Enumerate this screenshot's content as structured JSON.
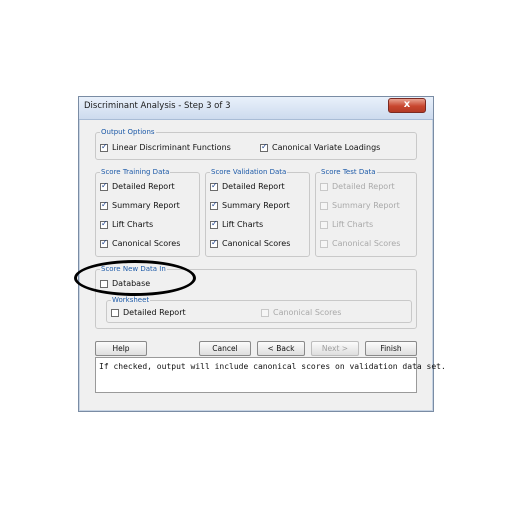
{
  "window": {
    "title": "Discriminant Analysis - Step 3 of 3",
    "close_glyph": "x",
    "close_icon": "close-icon"
  },
  "output_options": {
    "legend": "Output Options",
    "linear_discriminant": {
      "label": "Linear Discriminant Functions",
      "checked": true
    },
    "canonical_variate": {
      "label": "Canonical Variate Loadings",
      "checked": true
    }
  },
  "score_training": {
    "legend": "Score Training Data",
    "detailed_report": {
      "label": "Detailed Report",
      "checked": true
    },
    "summary_report": {
      "label": "Summary Report",
      "checked": true
    },
    "lift_charts": {
      "label": "Lift Charts",
      "checked": true
    },
    "canonical_scores": {
      "label": "Canonical Scores",
      "checked": true
    }
  },
  "score_validation": {
    "legend": "Score Validation Data",
    "detailed_report": {
      "label": "Detailed Report",
      "checked": true
    },
    "summary_report": {
      "label": "Summary Report",
      "checked": true
    },
    "lift_charts": {
      "label": "Lift Charts",
      "checked": true
    },
    "canonical_scores": {
      "label": "Canonical Scores",
      "checked": true
    }
  },
  "score_test": {
    "legend": "Score Test Data",
    "detailed_report": {
      "label": "Detailed Report",
      "checked": false,
      "enabled": false
    },
    "summary_report": {
      "label": "Summary Report",
      "checked": false,
      "enabled": false
    },
    "lift_charts": {
      "label": "Lift Charts",
      "checked": false,
      "enabled": false
    },
    "canonical_scores": {
      "label": "Canonical Scores",
      "checked": false,
      "enabled": false
    }
  },
  "score_new": {
    "legend": "Score New Data In",
    "database": {
      "label": "Database",
      "checked": false
    }
  },
  "worksheet": {
    "legend": "Worksheet",
    "detailed_report": {
      "label": "Detailed Report",
      "checked": false
    },
    "canonical_scores": {
      "label": "Canonical Scores",
      "checked": false,
      "enabled": false
    }
  },
  "buttons": {
    "help": "Help",
    "cancel": "Cancel",
    "back": "< Back",
    "next": "Next >",
    "finish": "Finish"
  },
  "help_text": "If checked, output will include canonical scores on validation data set.",
  "annotation": {
    "color": "#000000",
    "shape": "ellipse"
  }
}
